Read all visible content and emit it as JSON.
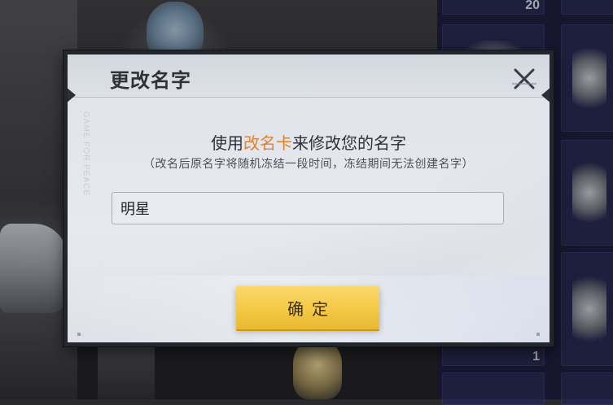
{
  "dialog": {
    "title": "更改名字",
    "side_text": "GAME FOR PEACE",
    "instruction_prefix": "使用",
    "instruction_highlight": "改名卡",
    "instruction_suffix": "来修改您的名字",
    "note": "（改名后原名字将随机冻结一段时间，冻结期间无法创建名字）",
    "name_value": "明星",
    "confirm_label": "确定",
    "highlight_color": "#e0822e",
    "confirm_color": "#f3c844"
  },
  "inventory": {
    "tiles": [
      {
        "count": "20",
        "item": "item-box"
      },
      {
        "count": "",
        "item": "weapon-part"
      },
      {
        "count": "",
        "item": "spring-part"
      },
      {
        "count": "1",
        "item": "key-item"
      }
    ]
  }
}
